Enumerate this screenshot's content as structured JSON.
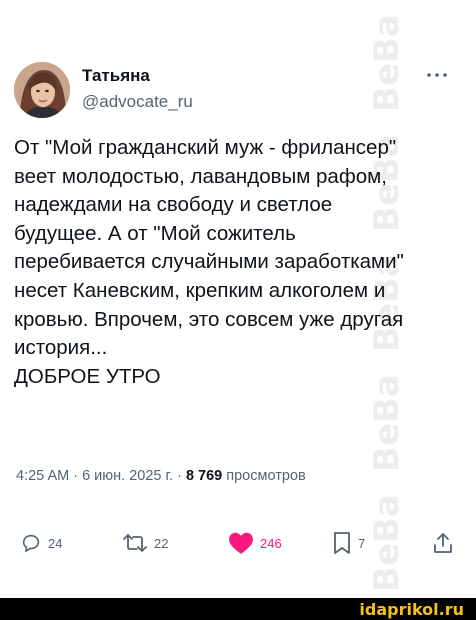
{
  "author": {
    "name": "Татьяна",
    "handle": "@advocate_ru"
  },
  "post": {
    "lines": [
      "От \"Мой гражданский муж -  фрилансер\"",
      "веет молодостью, лавандовым рафом,",
      "надеждами на свободу и светлое",
      "будущее. А от \"Мой сожитель",
      "перебивается случайными заработками\"",
      "несет Каневским, крепким алкоголем и",
      "кровью. Впрочем, это совсем уже другая",
      "история...",
      "ДОБРОЕ УТРО"
    ]
  },
  "meta": {
    "time_date": "4:25 AM · 6 июн. 2025 г. · ",
    "views_count": "8 769",
    "views_label": " просмотров"
  },
  "actions": {
    "replies": "24",
    "reposts": "22",
    "likes": "246",
    "bookmarks": "7"
  },
  "colors": {
    "text": "#0f1419",
    "secondary": "#536471",
    "like": "#f91880",
    "footer_brand": "#f2c21a"
  },
  "icons": [
    "more-icon",
    "reply-icon",
    "repost-icon",
    "like-icon",
    "bookmark-icon",
    "share-icon"
  ],
  "watermark": "BeBa",
  "footer": {
    "site": "idaprikol.ru"
  }
}
